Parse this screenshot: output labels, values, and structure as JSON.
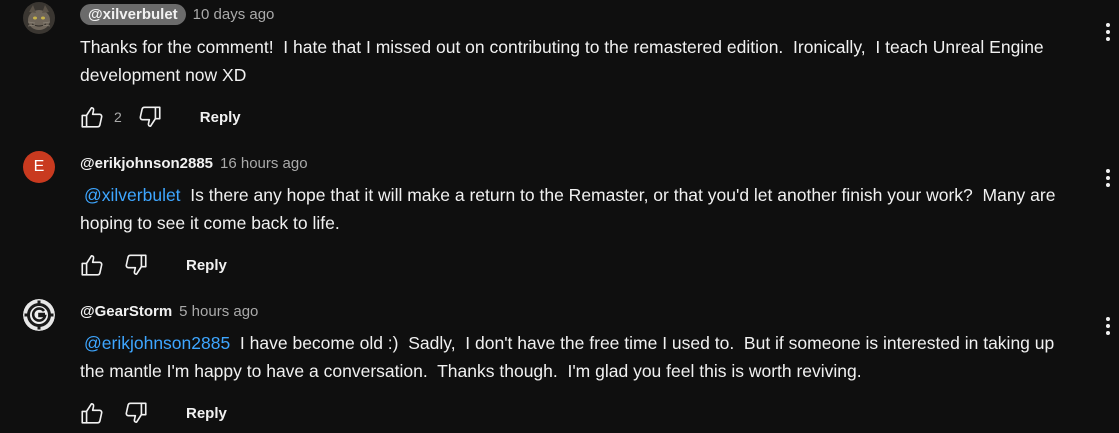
{
  "comments": [
    {
      "handle": "@xilverbulet",
      "time": "10 days ago",
      "mention": "",
      "text": "Thanks for the comment!  I hate that I missed out on contributing to the remastered edition.  Ironically,  I teach Unreal Engine development now XD",
      "likes": "2",
      "reply_label": "Reply",
      "avatar": "cat-photo-avatar"
    },
    {
      "handle": "@erikjohnson2885",
      "time": "16 hours ago",
      "mention": "@xilverbulet",
      "text": "  Is there any hope that it will make a return to the Remaster, or that you'd let another finish your work?  Many are hoping to see it come back to life.",
      "likes": "",
      "reply_label": "Reply",
      "avatar_letter": "E",
      "avatar_color": "#c93a1f"
    },
    {
      "handle": "@GearStorm",
      "time": "5 hours ago",
      "mention": "@erikjohnson2885",
      "text": "  I have become old :)  Sadly,  I don't have the free time I used to.  But if someone is interested in taking up the mantle I'm happy to have a conversation.  Thanks though.  I'm glad you feel this is worth reviving.",
      "likes": "",
      "reply_label": "Reply",
      "avatar": "gear-logo-avatar"
    }
  ],
  "colors": {
    "background": "#0f0f0f",
    "text": "#f1f1f1",
    "secondary": "#aaaaaa",
    "mention": "#3ea6ff",
    "pill": "#6b6b6b"
  }
}
